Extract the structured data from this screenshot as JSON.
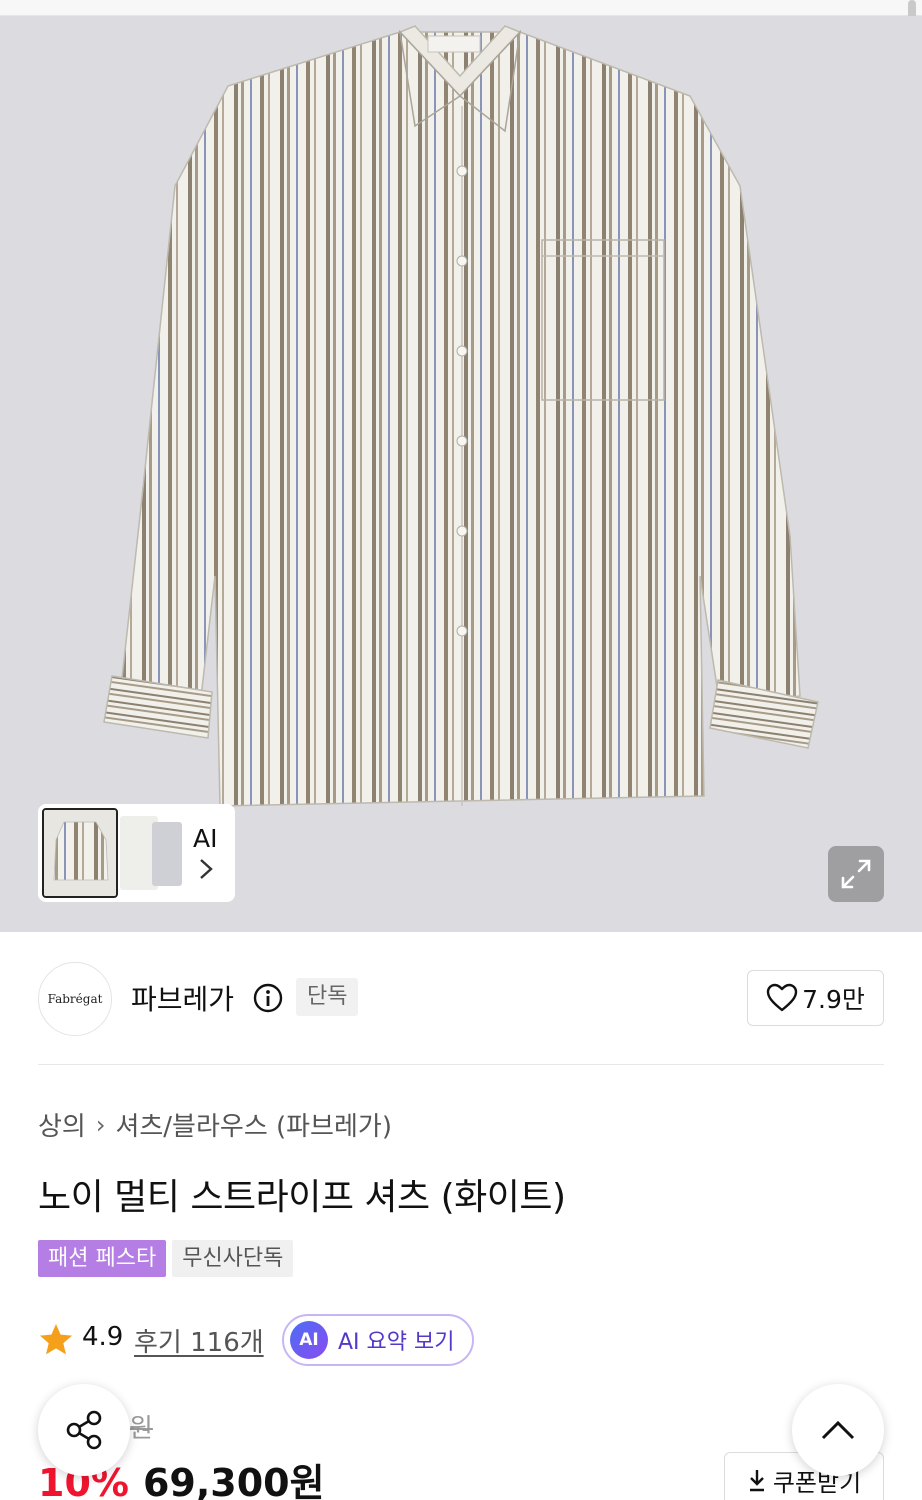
{
  "gallery": {
    "thumb_ai_label": "AI"
  },
  "brand": {
    "logo_text": "Fabrégat",
    "name": "파브레가",
    "badge": "단독",
    "like_count": "7.9만"
  },
  "breadcrumb": {
    "category": "상의",
    "subcategory": "셔츠/블라우스 (파브레가)"
  },
  "product": {
    "title": "노이 멀티 스트라이프 셔츠 (화이트)",
    "tags": [
      "패션 페스타",
      "무신사단독"
    ],
    "rating": "4.9",
    "review_text": "후기 116개",
    "ai_summary_label": "AI 요약 보기",
    "ai_chip": "AI",
    "original_price": "77,000원",
    "discount": "10%",
    "sale_price": "69,300원",
    "coupon_label": "쿠폰받기"
  },
  "colors": {
    "festa_tag": "#b57ee5",
    "discount": "#f0152f",
    "ai_accent": "#5538c8",
    "hero_bg": "#dcdce0"
  },
  "icons": {
    "info": "info-icon",
    "heart": "heart-icon",
    "star": "star-icon",
    "share": "share-icon",
    "chevron_up": "chevron-up-icon",
    "download": "download-icon",
    "expand": "expand-icon",
    "chevron_right": "chevron-right-icon"
  }
}
